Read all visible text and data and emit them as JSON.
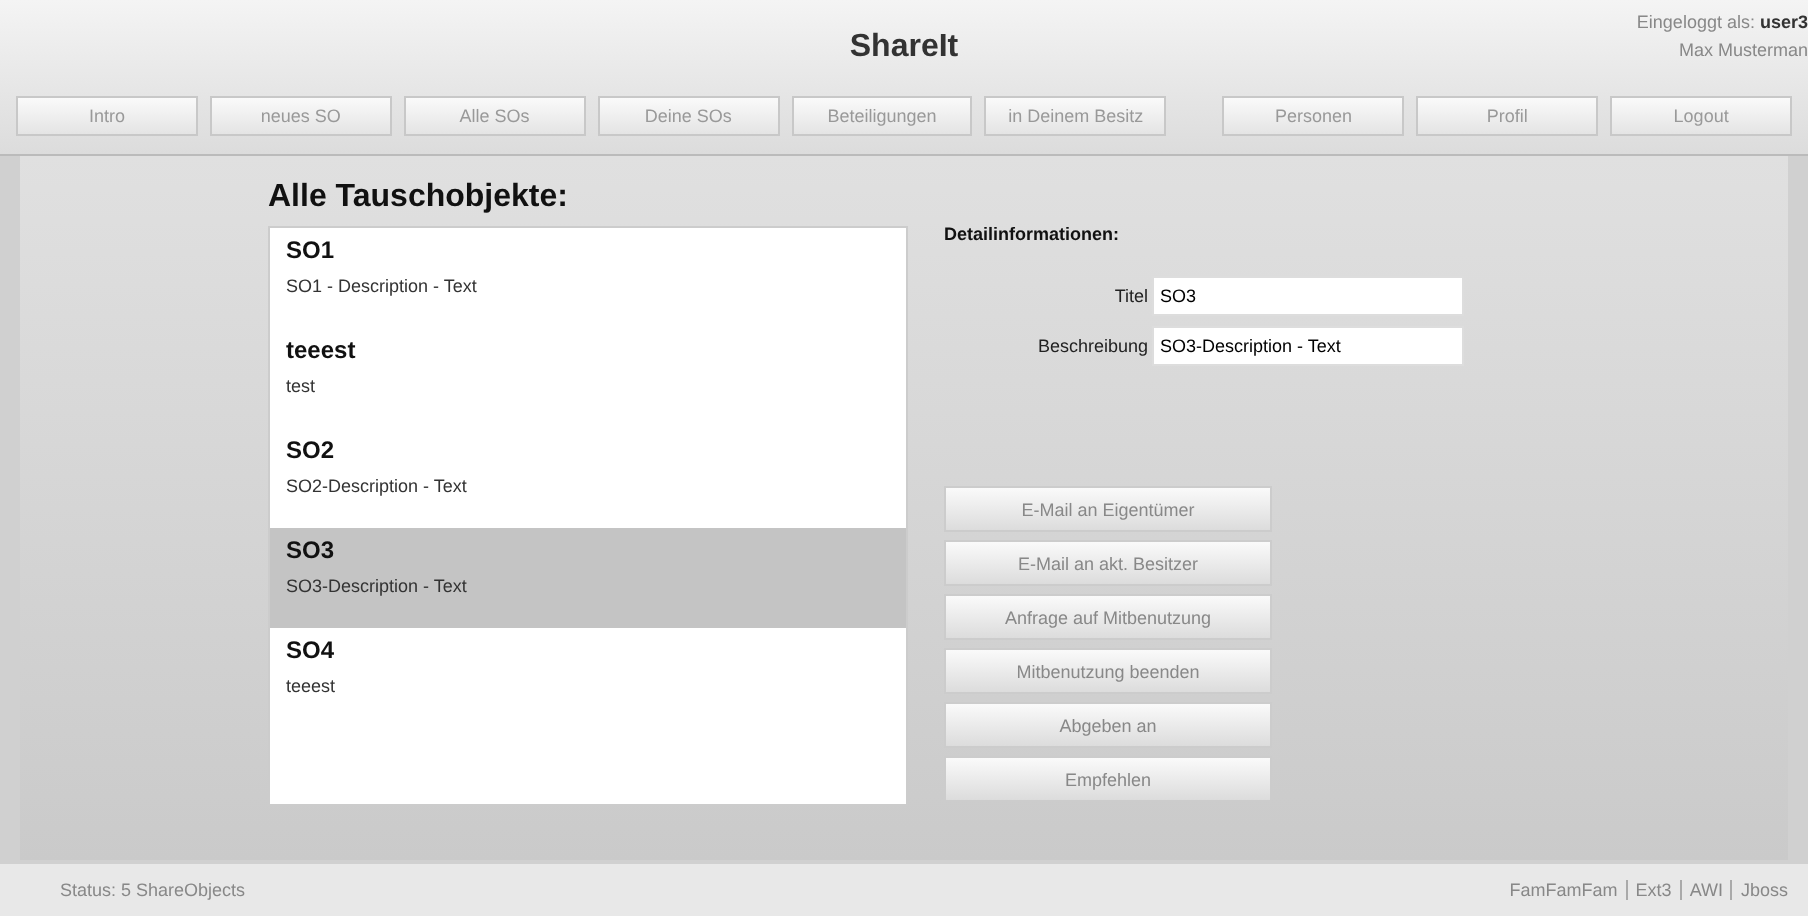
{
  "header": {
    "title": "ShareIt",
    "login_label": "Eingeloggt als:",
    "login_user": "user3",
    "user_name": "Max Musterman"
  },
  "nav": [
    {
      "label": "Intro"
    },
    {
      "label": "neues SO"
    },
    {
      "label": "Alle SOs"
    },
    {
      "label": "Deine SOs"
    },
    {
      "label": "Beteiligungen"
    },
    {
      "label": "in Deinem Besitz"
    },
    {
      "label": "Personen"
    },
    {
      "label": "Profil"
    },
    {
      "label": "Logout"
    }
  ],
  "list": {
    "title": "Alle Tauschobjekte:",
    "items": [
      {
        "name": "SO1",
        "description": "SO1 - Description - Text",
        "selected": false
      },
      {
        "name": "teeest",
        "description": "test",
        "selected": false
      },
      {
        "name": "SO2",
        "description": "SO2-Description - Text",
        "selected": false
      },
      {
        "name": "SO3",
        "description": "SO3-Description - Text",
        "selected": true
      },
      {
        "name": "SO4",
        "description": "teeest",
        "selected": false
      }
    ]
  },
  "details": {
    "title": "Detailinformationen:",
    "fields": [
      {
        "label": "Titel",
        "value": "SO3"
      },
      {
        "label": "Beschreibung",
        "value": "SO3-Description - Text"
      }
    ],
    "actions": [
      "E-Mail an Eigentümer",
      "E-Mail an akt. Besitzer",
      "Anfrage auf Mitbenutzung",
      "Mitbenutzung beenden",
      "Abgeben an",
      "Empfehlen"
    ]
  },
  "status_bar": {
    "status": "Status: 5 ShareObjects",
    "links": [
      "FamFamFam",
      "Ext3",
      "AWI",
      "Jboss"
    ]
  }
}
